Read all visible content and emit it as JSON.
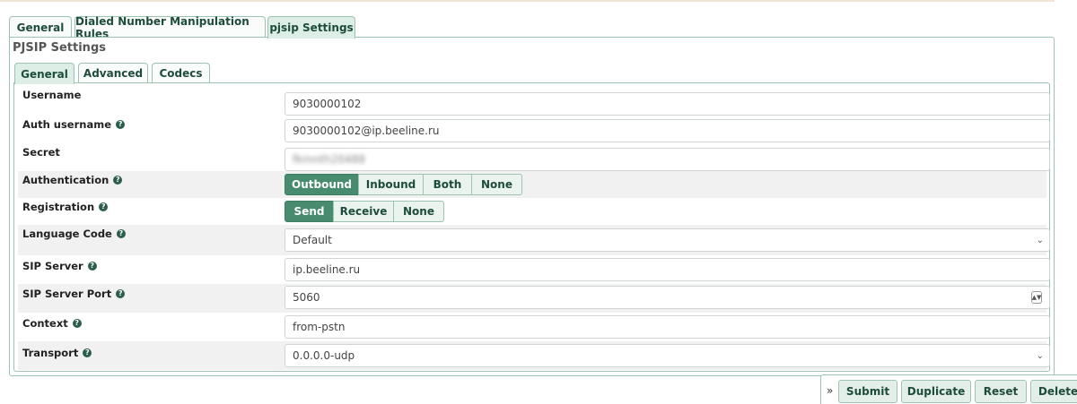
{
  "outer_tabs": [
    {
      "label": "General"
    },
    {
      "label": "Dialed Number Manipulation Rules"
    },
    {
      "label": "pjsip Settings"
    }
  ],
  "panel_title": "PJSIP Settings",
  "inner_tabs": [
    {
      "label": "General"
    },
    {
      "label": "Advanced"
    },
    {
      "label": "Codecs"
    }
  ],
  "fields": {
    "username": {
      "label": "Username",
      "value": "9030000102"
    },
    "auth_username": {
      "label": "Auth username",
      "value": "9030000102@ip.beeline.ru"
    },
    "secret": {
      "label": "Secret",
      "value": "fkmnth20488"
    },
    "authentication": {
      "label": "Authentication",
      "options": [
        "Outbound",
        "Inbound",
        "Both",
        "None"
      ],
      "selected": "Outbound"
    },
    "registration": {
      "label": "Registration",
      "options": [
        "Send",
        "Receive",
        "None"
      ],
      "selected": "Send"
    },
    "language_code": {
      "label": "Language Code",
      "value": "Default"
    },
    "sip_server": {
      "label": "SIP Server",
      "value": "ip.beeline.ru"
    },
    "sip_server_port": {
      "label": "SIP Server Port",
      "value": "5060"
    },
    "context": {
      "label": "Context",
      "value": "from-pstn"
    },
    "transport": {
      "label": "Transport",
      "value": "0.0.0.0-udp"
    }
  },
  "help_glyph": "?",
  "icons": {
    "help": "question-circle-icon",
    "select": "chevron-down-icon",
    "spinner": "spinner-arrows-icon",
    "expand": "double-chevron-right-icon"
  },
  "actions": {
    "expand_glyph": "»",
    "submit": "Submit",
    "duplicate": "Duplicate",
    "reset": "Reset",
    "delete": "Delete"
  },
  "colors": {
    "accent": "#488c70",
    "tab_border": "#9cc4b0",
    "text_dark_green": "#1d4c3b"
  }
}
